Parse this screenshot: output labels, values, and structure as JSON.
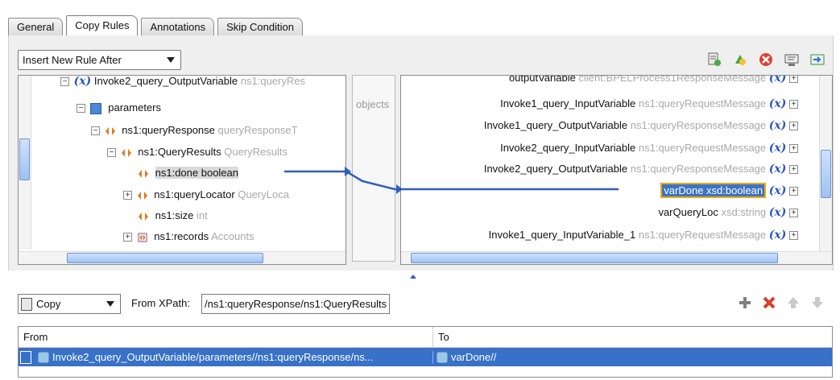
{
  "tabs": [
    "General",
    "Copy Rules",
    "Annotations",
    "Skip Condition"
  ],
  "active_tab": "Copy Rules",
  "insert_dropdown": {
    "value": "Insert New Rule After"
  },
  "left_tree": {
    "rows": [
      {
        "label": "Invoke2_query_OutputVariable",
        "type": "ns1:queryRes"
      },
      {
        "label": "parameters",
        "type": ""
      },
      {
        "label": "ns1:queryResponse",
        "type": "queryResponseT"
      },
      {
        "label": "ns1:QueryResults",
        "type": "QueryResults"
      },
      {
        "label": "ns1:done boolean",
        "type": ""
      },
      {
        "label": "ns1:queryLocator",
        "type": "QueryLoca"
      },
      {
        "label": "ns1:size",
        "type": "int"
      },
      {
        "label": "ns1:records",
        "type": "Accounts"
      }
    ]
  },
  "middle": {
    "label": "objects"
  },
  "right_tree": {
    "rows": [
      {
        "label": "outputVariable",
        "type": "client:BPELProcess1ResponseMessage"
      },
      {
        "label": "Invoke1_query_InputVariable",
        "type": "ns1:queryRequestMessage"
      },
      {
        "label": "Invoke1_query_OutputVariable",
        "type": "ns1:queryResponseMessage"
      },
      {
        "label": "Invoke2_query_InputVariable",
        "type": "ns1:queryRequestMessage"
      },
      {
        "label": "Invoke2_query_OutputVariable",
        "type": "ns1:queryResponseMessage"
      },
      {
        "label": "varDone xsd:boolean",
        "type": ""
      },
      {
        "label": "varQueryLoc",
        "type": "xsd:string"
      },
      {
        "label": "Invoke1_query_InputVariable_1",
        "type": "ns1:queryRequestMessage"
      }
    ],
    "x_symbol": "(x)"
  },
  "copy_select": {
    "value": "Copy"
  },
  "from_xpath": {
    "label": "From XPath:",
    "value": "/ns1:queryResponse/ns1:QueryResults"
  },
  "grid": {
    "headers": [
      "From",
      "To"
    ],
    "rows": [
      {
        "from": "Invoke2_query_OutputVariable/parameters//ns1:queryResponse/ns...",
        "to": "varDone//"
      }
    ]
  },
  "colors": {
    "selection": "#3771c8",
    "highlight_border": "#f2a900",
    "link_line": "#2e5fbf"
  }
}
